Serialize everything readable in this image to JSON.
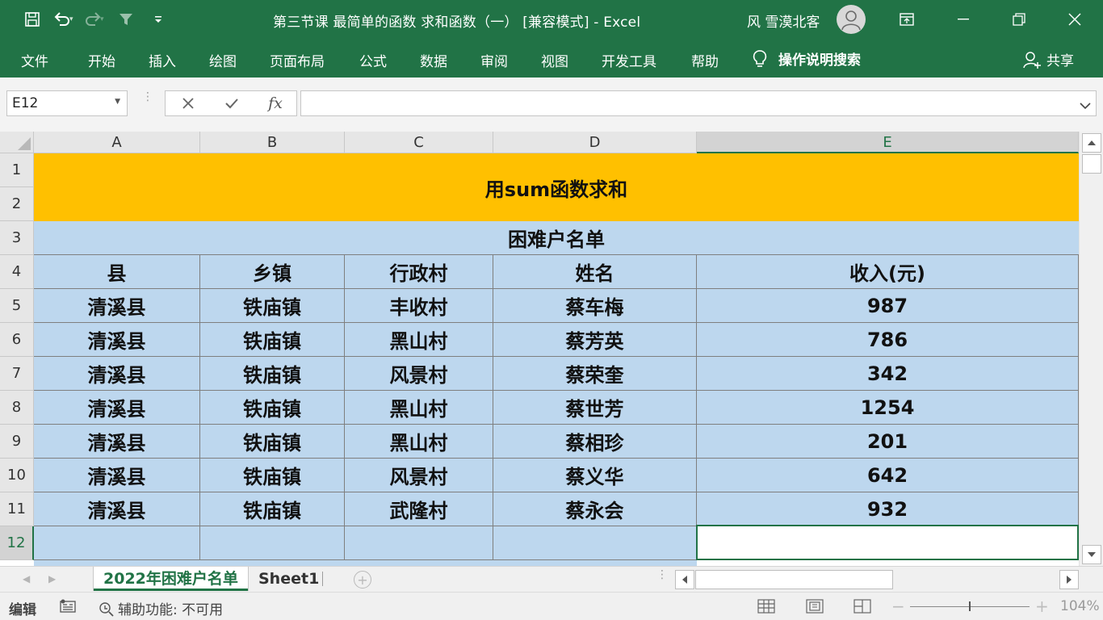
{
  "window": {
    "title": "第三节课  最简单的函数  求和函数（一）  [兼容模式]  -  Excel",
    "user_name": "风 雪漠北客"
  },
  "qat_icons": [
    "save-icon",
    "undo-icon",
    "redo-icon",
    "filter-icon",
    "customize-icon"
  ],
  "ribbon": {
    "tabs": [
      "文件",
      "开始",
      "插入",
      "绘图",
      "页面布局",
      "公式",
      "数据",
      "审阅",
      "视图",
      "开发工具",
      "帮助"
    ],
    "tell_me": "操作说明搜索",
    "share": "共享"
  },
  "formula_bar": {
    "name_box": "E12",
    "formula": "",
    "fx_label": "fx"
  },
  "grid": {
    "columns": [
      "A",
      "B",
      "C",
      "D",
      "E"
    ],
    "rows": [
      "1",
      "2",
      "3",
      "4",
      "5",
      "6",
      "7",
      "8",
      "9",
      "10",
      "11",
      "12"
    ],
    "active_cell": "E12",
    "title": "用sum函数求和",
    "subtitle": "困难户名单",
    "headers": [
      "县",
      "乡镇",
      "行政村",
      "姓名",
      "收入(元)"
    ],
    "data": [
      [
        "清溪县",
        "铁庙镇",
        "丰收村",
        "蔡车梅",
        "987"
      ],
      [
        "清溪县",
        "铁庙镇",
        "黑山村",
        "蔡芳英",
        "786"
      ],
      [
        "清溪县",
        "铁庙镇",
        "风景村",
        "蔡荣奎",
        "342"
      ],
      [
        "清溪县",
        "铁庙镇",
        "黑山村",
        "蔡世芳",
        "1254"
      ],
      [
        "清溪县",
        "铁庙镇",
        "黑山村",
        "蔡相珍",
        "201"
      ],
      [
        "清溪县",
        "铁庙镇",
        "风景村",
        "蔡义华",
        "642"
      ],
      [
        "清溪县",
        "铁庙镇",
        "武隆村",
        "蔡永会",
        "932"
      ]
    ]
  },
  "sheet_tabs": {
    "active": "2022年困难户名单",
    "other": "Sheet1"
  },
  "status": {
    "mode": "编辑",
    "accessibility": "辅助功能: 不可用",
    "zoom": "104%"
  },
  "colors": {
    "excel_green": "#217346",
    "title_fill": "#ffc000",
    "table_fill": "#bdd7ee"
  }
}
